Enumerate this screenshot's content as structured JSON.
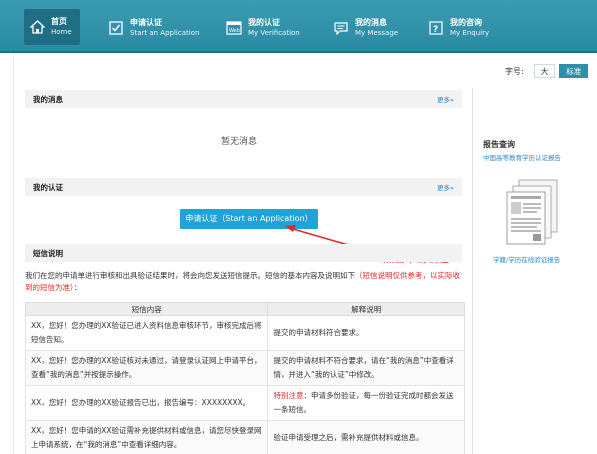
{
  "nav": {
    "items": [
      {
        "zh": "首页",
        "en": "Home",
        "icon": "home-icon"
      },
      {
        "zh": "申请认证",
        "en": "Start an Application",
        "icon": "checkbox-icon"
      },
      {
        "zh": "我的认证",
        "en": "My Verification",
        "icon": "web-doc-icon"
      },
      {
        "zh": "我的消息",
        "en": "My Message",
        "icon": "message-icon"
      },
      {
        "zh": "我的咨询",
        "en": "My Enquiry",
        "icon": "question-icon"
      }
    ]
  },
  "fontsize": {
    "label": "字号:",
    "large": "大",
    "standard": "标准"
  },
  "messages": {
    "title": "我的消息",
    "more": "更多»",
    "empty": "暂无消息"
  },
  "verification": {
    "title": "我的认证",
    "more": "更多»",
    "apply_button": "申请认证（Start an Application）"
  },
  "annotation": "点击申请认证",
  "sms": {
    "title": "短信说明",
    "intro": "我们在您的申请单进行审核和出具验证结果时，将会向您发送短信提示。短信的基本内容及说明如下",
    "intro_note": "（短信说明仅供参考，以实际收到的短信为准）",
    "intro_end": "：",
    "headers": [
      "短信内容",
      "解释说明"
    ],
    "rows": [
      {
        "content": "XX，您好！您办理的XX验证已进入资料信息审核环节，审核完成后将短信告知。",
        "note": "提交的申请材料符合要求。",
        "note_prefix": ""
      },
      {
        "content": "XX，您好！您办理的XX验证核对未通过，请登录认证网上申请平台，查看“我的消息”并按提示操作。",
        "note": "提交的申请材料不符合要求，请在“我的消息”中查看详情，并进入“我的认证”中修改。",
        "note_prefix": ""
      },
      {
        "content": "XX，您好！您办理的XX验证报告已出，报告编号：XXXXXXXX。",
        "note": "：申请多份验证，每一份验证完成时都会发送一条短信。",
        "note_prefix": "特别注意"
      },
      {
        "content": "XX，您好！您申请的XX验证需补充提供材料或信息，请您尽快登录网上申请系统，在“我的消息”中查看详细内容。",
        "note": "验证申请受理之后，需补充提供材料或信息。",
        "note_prefix": ""
      }
    ]
  },
  "sidebar": {
    "title": "报告查询",
    "link1": "中国高等教育学历认证报告",
    "link2": "学籍/学历在线验证报告"
  },
  "colors": {
    "nav": "#2e8fa8",
    "accent_button": "#1fa3d8",
    "annotation": "#e3272a",
    "link": "#2b87c8"
  }
}
